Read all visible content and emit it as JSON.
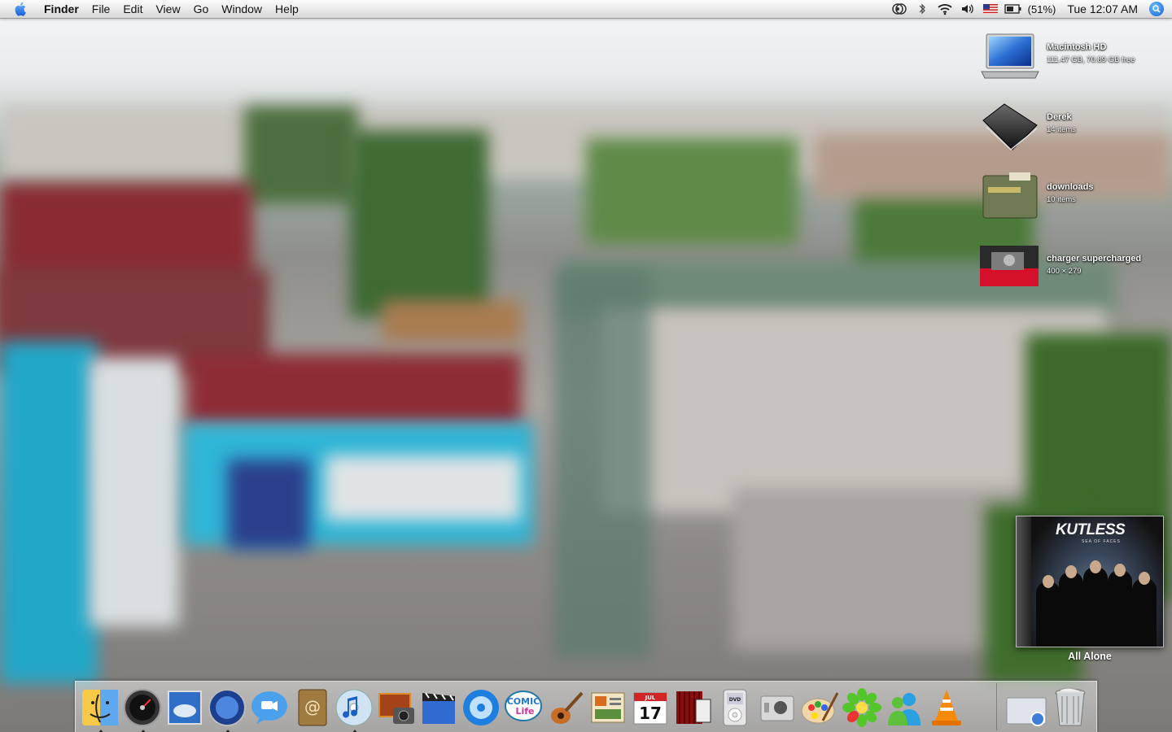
{
  "menubar": {
    "app_name": "Finder",
    "menus": [
      "File",
      "Edit",
      "View",
      "Go",
      "Window",
      "Help"
    ],
    "battery": "(51%)",
    "clock": "Tue 12:07 AM"
  },
  "desktop_icons": [
    {
      "label": "Macintosh HD",
      "sub": "111.47 GB, 70.89 GB free",
      "icon": "laptop-drive-icon"
    },
    {
      "label": "Derek",
      "sub": "14 items",
      "icon": "black-folder-icon"
    },
    {
      "label": "downloads",
      "sub": "10 items",
      "icon": "green-folder-icon"
    },
    {
      "label": "charger supercharged",
      "sub": "400 × 279",
      "icon": "image-thumbnail-icon"
    }
  ],
  "album": {
    "band": "KUTLESS",
    "subtitle": "SEA OF FACES",
    "track": "All Alone"
  },
  "dock": {
    "apps": [
      "finder-icon",
      "dashboard-icon",
      "weather-icon",
      "spaces-icon",
      "ichat-icon",
      "address-book-icon",
      "itunes-icon",
      "iphoto-icon",
      "imovie-icon",
      "dvd-player-icon",
      "comic-life-icon",
      "garageband-icon",
      "iweb-icon",
      "ical-icon",
      "front-row-icon",
      "ipod-icon",
      "boot-camp-icon",
      "paint-icon",
      "icq-icon",
      "msn-messenger-icon",
      "vlc-icon"
    ],
    "ical_month": "JUL",
    "ical_day": "17",
    "ipod_label": "DVD"
  }
}
